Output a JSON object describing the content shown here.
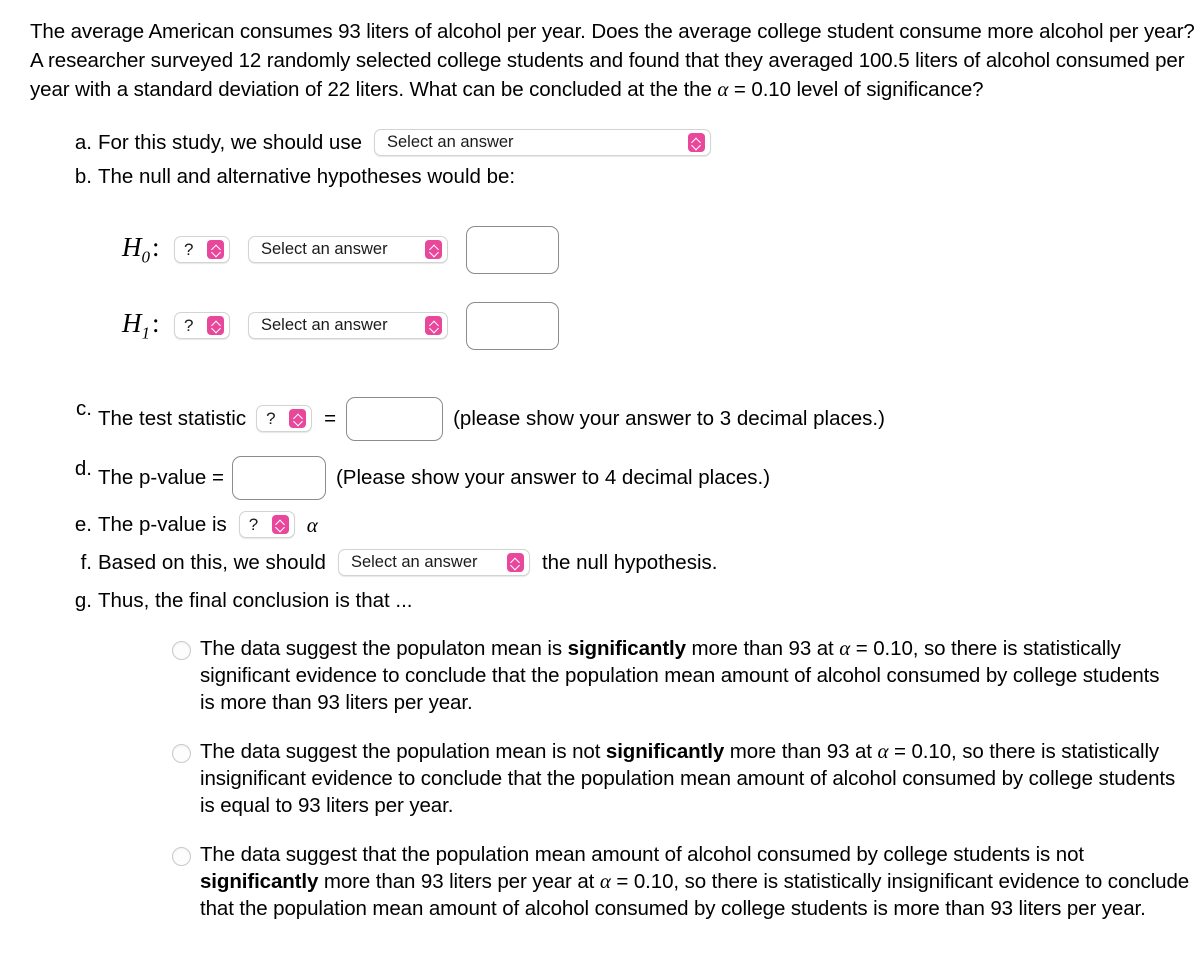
{
  "problem": {
    "statement": "The average American consumes 93 liters of alcohol per year. Does the average college student consume more alcohol per year? A researcher surveyed 12 randomly selected college students and found that they averaged 100.5 liters of alcohol consumed per year with a standard deviation of 22 liters. What can be concluded at the",
    "statement_tail": "= 0.10 level of significance?",
    "statement_lead": "the",
    "alpha_symbol": "α"
  },
  "accent_color": "#e8479b",
  "placeholders": {
    "select_answer": "Select an answer",
    "question_mark": "?"
  },
  "items": {
    "a": {
      "marker": "a.",
      "text": "For this study, we should use",
      "select_value": "Select an answer"
    },
    "b": {
      "marker": "b.",
      "text": "The null and alternative hypotheses would be:",
      "hypotheses": [
        {
          "label": "H",
          "subscript": "0",
          "colon": ":",
          "operand_select": "?",
          "answer_select": "Select an answer",
          "value_input": ""
        },
        {
          "label": "H",
          "subscript": "1",
          "colon": ":",
          "operand_select": "?",
          "answer_select": "Select an answer",
          "value_input": ""
        }
      ]
    },
    "c": {
      "marker": "c.",
      "text": "The test statistic",
      "stat_select": "?",
      "equals": "=",
      "value_input": "",
      "note": "(please show your answer to 3 decimal places.)"
    },
    "d": {
      "marker": "d.",
      "text": "The p-value =",
      "value_input": "",
      "note": "(Please show your answer to 4 decimal places.)"
    },
    "e": {
      "marker": "e.",
      "text": "The p-value is",
      "compare_select": "?",
      "alpha": "α"
    },
    "f": {
      "marker": "f.",
      "text_before": "Based on this, we should",
      "decision_select": "Select an answer",
      "text_after": "the null hypothesis."
    },
    "g": {
      "marker": "g.",
      "text": "Thus, the final conclusion is that ...",
      "options": [
        {
          "part1": "The data suggest the populaton mean is ",
          "bold": "significantly",
          "part2": " more than 93 at ",
          "alpha": "α",
          "part3": " = 0.10, so there is statistically significant evidence to conclude that the population mean amount of alcohol consumed by college students is more than 93 liters per year.",
          "selected": false
        },
        {
          "part1": "The data suggest the population mean is not ",
          "bold": "significantly",
          "part2": " more than 93 at ",
          "alpha": "α",
          "part3": " = 0.10, so there is statistically insignificant evidence to conclude that the population mean amount of alcohol consumed by college students is equal to 93 liters per year.",
          "selected": false
        },
        {
          "part1": "The data suggest that the population mean amount of alcohol consumed by college students is not ",
          "bold": "significantly",
          "part2": " more than 93 liters per year at ",
          "alpha": "α",
          "part3": " = 0.10, so there is statistically insignificant evidence to conclude that the population mean amount of alcohol consumed by college students is more than 93 liters per year.",
          "selected": false
        }
      ]
    }
  }
}
